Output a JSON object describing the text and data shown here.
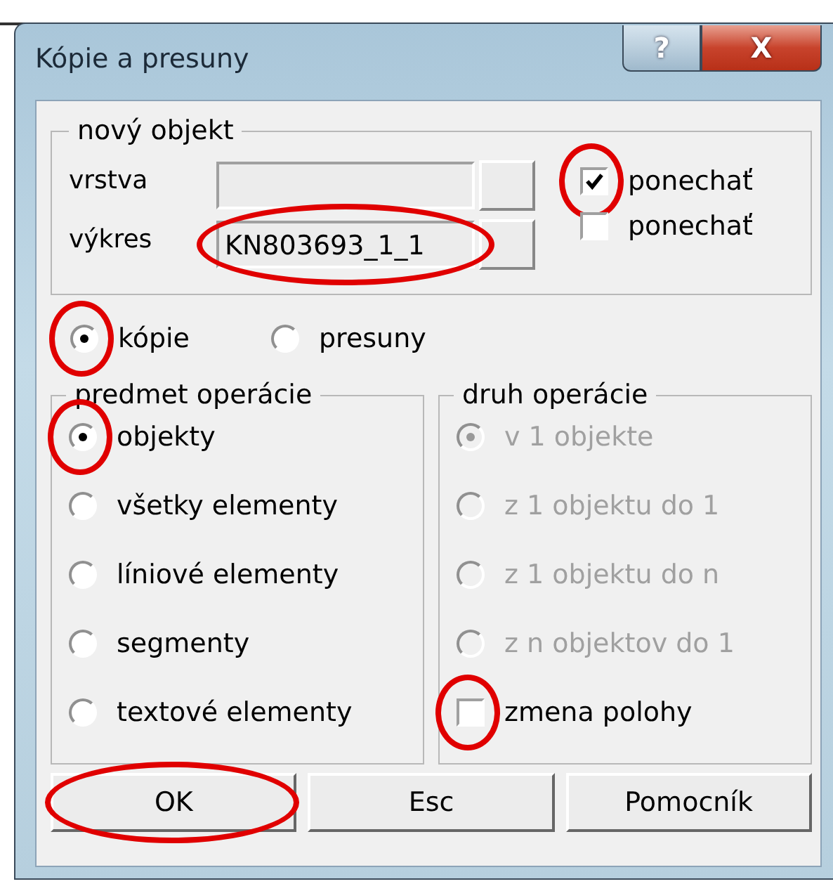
{
  "window": {
    "title": "Kópie a presuny",
    "controls": [
      {
        "kind": "help",
        "label": "?"
      },
      {
        "kind": "close",
        "label": "X"
      }
    ]
  },
  "new_object": {
    "title": "nový objekt",
    "fields": [
      {
        "label": "vrstva",
        "highlighted": false
      },
      {
        "label": "výkres",
        "value": "KN803693_1_1",
        "highlighted": true
      }
    ],
    "checkboxes": [
      {
        "label": "ponechať",
        "checked": true,
        "highlighted": true
      },
      {
        "label": "ponechať",
        "checked": false,
        "highlighted": false
      }
    ]
  },
  "mode": [
    {
      "label": "kópie",
      "selected": true,
      "highlighted": true
    },
    {
      "label": "presuny",
      "selected": false,
      "highlighted": false
    }
  ],
  "subject": {
    "title": "predmet operácie",
    "options": [
      {
        "label": "objekty",
        "selected": true,
        "highlighted": true
      },
      {
        "label": "všetky elementy",
        "selected": false,
        "highlighted": false
      },
      {
        "label": "líniové elementy",
        "selected": false,
        "highlighted": false
      },
      {
        "label": "segmenty",
        "selected": false,
        "highlighted": false
      },
      {
        "label": "textové elementy",
        "selected": false,
        "highlighted": false
      }
    ]
  },
  "operation": {
    "title": "druh operácie",
    "options": [
      {
        "label": "v 1 objekte",
        "selected": true,
        "disabled": true
      },
      {
        "label": "z 1 objektu do 1",
        "selected": false,
        "disabled": true
      },
      {
        "label": "z 1 objektu do n",
        "selected": false,
        "disabled": true
      },
      {
        "label": "z n objektov do 1",
        "selected": false,
        "disabled": true
      }
    ],
    "checkbox": {
      "label": "zmena polohy",
      "checked": false,
      "highlighted": true
    }
  },
  "buttons": [
    {
      "label": "OK",
      "highlighted": true
    },
    {
      "label": "Esc",
      "highlighted": false
    },
    {
      "label": "Pomocník",
      "highlighted": false
    }
  ]
}
